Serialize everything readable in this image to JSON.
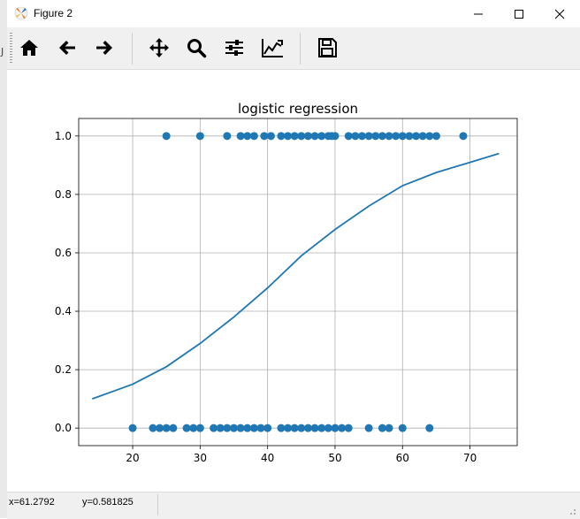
{
  "window": {
    "title": "Figure 2",
    "buttons": {
      "minimize": "minimize",
      "maximize": "maximize",
      "close": "close"
    }
  },
  "side_strip": {
    "mark": "J"
  },
  "toolbar": {
    "items": [
      {
        "name": "home",
        "icon": "home-icon"
      },
      {
        "name": "back",
        "icon": "arrow-left-icon"
      },
      {
        "name": "forward",
        "icon": "arrow-right-icon"
      },
      {
        "name": "pan",
        "icon": "move-icon"
      },
      {
        "name": "zoom",
        "icon": "magnifier-icon"
      },
      {
        "name": "configure-subplots",
        "icon": "sliders-icon"
      },
      {
        "name": "edit-axis",
        "icon": "line-chart-icon"
      },
      {
        "name": "save",
        "icon": "floppy-disk-icon"
      }
    ]
  },
  "status": {
    "x": "x=61.2792",
    "y": "y=0.581825"
  },
  "colors": {
    "series": "#1f77b4",
    "grid": "#b0b0b0",
    "toolbar_bg": "#f0f0f0"
  },
  "chart_data": {
    "type": "scatter",
    "title": "logistic regression",
    "xlabel": "",
    "ylabel": "",
    "xlim": [
      12,
      77
    ],
    "ylim": [
      -0.06,
      1.06
    ],
    "xticks": [
      20,
      30,
      40,
      50,
      60,
      70
    ],
    "yticks": [
      0.0,
      0.2,
      0.4,
      0.6,
      0.8,
      1.0
    ],
    "ytick_labels": [
      "0.0",
      "0.2",
      "0.4",
      "0.6",
      "0.8",
      "1.0"
    ],
    "grid": true,
    "series": [
      {
        "kind": "scatter",
        "x": [
          25,
          30,
          34,
          36,
          37,
          38,
          39.5,
          40.5,
          42,
          43,
          44,
          45,
          46,
          47,
          48,
          49,
          49.5,
          50,
          52,
          53,
          54,
          55,
          56,
          57,
          58,
          59,
          60,
          61,
          62,
          63,
          64,
          65,
          69,
          20,
          23,
          24,
          25,
          26,
          28,
          29,
          30,
          32,
          33,
          34,
          35,
          36,
          37,
          38,
          39,
          40,
          42,
          43,
          44,
          45,
          46,
          47,
          48,
          49,
          50,
          51,
          52,
          55,
          57,
          58,
          60,
          64
        ],
        "y": [
          1,
          1,
          1,
          1,
          1,
          1,
          1,
          1,
          1,
          1,
          1,
          1,
          1,
          1,
          1,
          1,
          1,
          1,
          1,
          1,
          1,
          1,
          1,
          1,
          1,
          1,
          1,
          1,
          1,
          1,
          1,
          1,
          1,
          0,
          0,
          0,
          0,
          0,
          0,
          0,
          0,
          0,
          0,
          0,
          0,
          0,
          0,
          0,
          0,
          0,
          0,
          0,
          0,
          0,
          0,
          0,
          0,
          0,
          0,
          0,
          0,
          0,
          0,
          0,
          0,
          0
        ]
      },
      {
        "kind": "line",
        "x": [
          14,
          20,
          25,
          30,
          35,
          40,
          45,
          50,
          55,
          60,
          65,
          70,
          74.3
        ],
        "y": [
          0.1,
          0.15,
          0.21,
          0.29,
          0.38,
          0.48,
          0.59,
          0.68,
          0.76,
          0.83,
          0.875,
          0.91,
          0.94
        ]
      }
    ]
  }
}
